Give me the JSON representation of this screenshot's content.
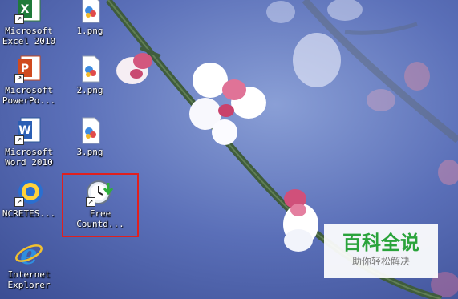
{
  "desktop": {
    "icons": [
      {
        "id": "excel",
        "label": "Microsoft\nExcel 2010",
        "icon": "excel-icon"
      },
      {
        "id": "powerpoint",
        "label": "Microsoft\nPowerPo...",
        "icon": "powerpoint-icon"
      },
      {
        "id": "word",
        "label": "Microsoft\nWord 2010",
        "icon": "word-icon"
      },
      {
        "id": "ncretes",
        "label": "NCRETES...",
        "icon": "ncretes-icon"
      },
      {
        "id": "ie",
        "label": "Internet\nExplorer",
        "icon": "internet-explorer-icon"
      },
      {
        "id": "png1",
        "label": "1.png",
        "icon": "image-file-icon"
      },
      {
        "id": "png2",
        "label": "2.png",
        "icon": "image-file-icon"
      },
      {
        "id": "png3",
        "label": "3.png",
        "icon": "image-file-icon"
      },
      {
        "id": "countdown",
        "label": "Free\nCountd...",
        "icon": "clock-download-icon"
      }
    ],
    "highlight_color": "#e0201e"
  },
  "watermark": {
    "title": "百科全说",
    "subtitle": "助你轻松解决",
    "title_color": "#2aa33b"
  }
}
